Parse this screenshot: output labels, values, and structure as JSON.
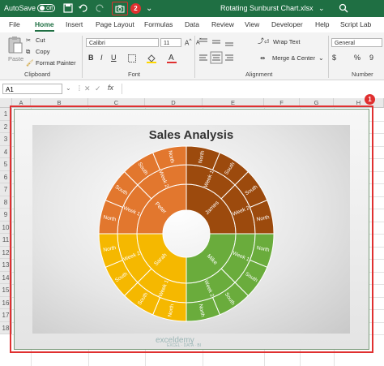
{
  "titlebar": {
    "autosave_label": "AutoSave",
    "autosave_state": "Off",
    "filename": "Rotating Sunburst Chart.xlsx",
    "badge_camera": "2"
  },
  "menu": {
    "tabs": [
      "File",
      "Home",
      "Insert",
      "Page Layout",
      "Formulas",
      "Data",
      "Review",
      "View",
      "Developer",
      "Help",
      "Script Lab"
    ],
    "active": "Home"
  },
  "ribbon": {
    "clipboard": {
      "paste": "Paste",
      "cut": "Cut",
      "copy": "Copy",
      "format_painter": "Format Painter",
      "label": "Clipboard"
    },
    "font": {
      "font_name": "Calibri",
      "font_size": "11",
      "bold": "B",
      "italic": "I",
      "underline": "U",
      "label": "Font"
    },
    "alignment": {
      "wrap_text": "Wrap Text",
      "merge_center": "Merge & Center",
      "label": "Alignment"
    },
    "number": {
      "format": "General",
      "currency": "$",
      "percent": "%",
      "comma": "9",
      "label": "Number"
    }
  },
  "formula_bar": {
    "name_box": "A1",
    "fx": "fx",
    "value": ""
  },
  "sheet": {
    "columns": [
      "A",
      "B",
      "C",
      "D",
      "E",
      "F",
      "G",
      "H"
    ],
    "rows": [
      "1",
      "2",
      "3",
      "4",
      "5",
      "6",
      "7",
      "8",
      "9",
      "10",
      "11",
      "12",
      "13",
      "14",
      "15",
      "16",
      "17",
      "18"
    ],
    "selection_badge": "1"
  },
  "chart": {
    "title": "Sales Analysis",
    "watermark": "exceldemy",
    "watermark_sub": "EXCEL · DATA · BI"
  },
  "chart_data": {
    "type": "sunburst",
    "title": "Sales Analysis",
    "hierarchy": [
      {
        "name": "James",
        "color": "#9c4a0d",
        "children": [
          {
            "name": "Week 1",
            "children": [
              {
                "name": "North"
              },
              {
                "name": "South"
              }
            ]
          },
          {
            "name": "Week 2",
            "children": [
              {
                "name": "South"
              },
              {
                "name": "North"
              }
            ]
          }
        ]
      },
      {
        "name": "Mike",
        "color": "#6aac3c",
        "children": [
          {
            "name": "Week 1",
            "children": [
              {
                "name": "North"
              },
              {
                "name": "South"
              }
            ]
          },
          {
            "name": "Week 2",
            "children": [
              {
                "name": "South"
              },
              {
                "name": "North"
              }
            ]
          }
        ]
      },
      {
        "name": "Sarah",
        "color": "#f5b800",
        "children": [
          {
            "name": "Week 1",
            "children": [
              {
                "name": "North"
              },
              {
                "name": "South"
              }
            ]
          },
          {
            "name": "Week 2",
            "children": [
              {
                "name": "South"
              },
              {
                "name": "North"
              }
            ]
          }
        ]
      },
      {
        "name": "Peter",
        "color": "#e2772e",
        "children": [
          {
            "name": "Week 1",
            "children": [
              {
                "name": "North"
              },
              {
                "name": "South"
              }
            ]
          },
          {
            "name": "Week 2",
            "children": [
              {
                "name": "South"
              },
              {
                "name": "North"
              }
            ]
          }
        ]
      }
    ]
  }
}
